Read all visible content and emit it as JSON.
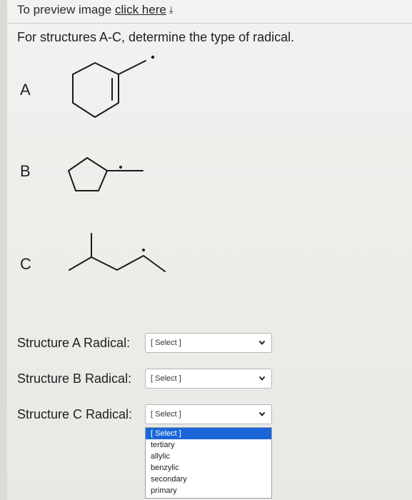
{
  "preview": {
    "prefix": "To preview image",
    "link_text": "click here",
    "download_glyph": "⤓"
  },
  "question": "For structures A-C, determine the type of radical.",
  "structures": [
    {
      "letter": "A",
      "shape": "cyclohexene-radical"
    },
    {
      "letter": "B",
      "shape": "cyclopentyl-ethyl-radical"
    },
    {
      "letter": "C",
      "shape": "branched-alkyl-radical"
    }
  ],
  "rows": [
    {
      "label": "Structure A Radical:",
      "value": "[ Select ]"
    },
    {
      "label": "Structure B Radical:",
      "value": "[ Select ]"
    },
    {
      "label": "Structure C Radical:",
      "value": "[ Select ]"
    }
  ],
  "dropdown": {
    "selected_index": 0,
    "options": [
      "[ Select ]",
      "tertiary",
      "allylic",
      "benzylic",
      "secondary",
      "primary"
    ]
  },
  "colors": {
    "selected_option_bg": "#1a66d9",
    "background": "#eceeea"
  }
}
